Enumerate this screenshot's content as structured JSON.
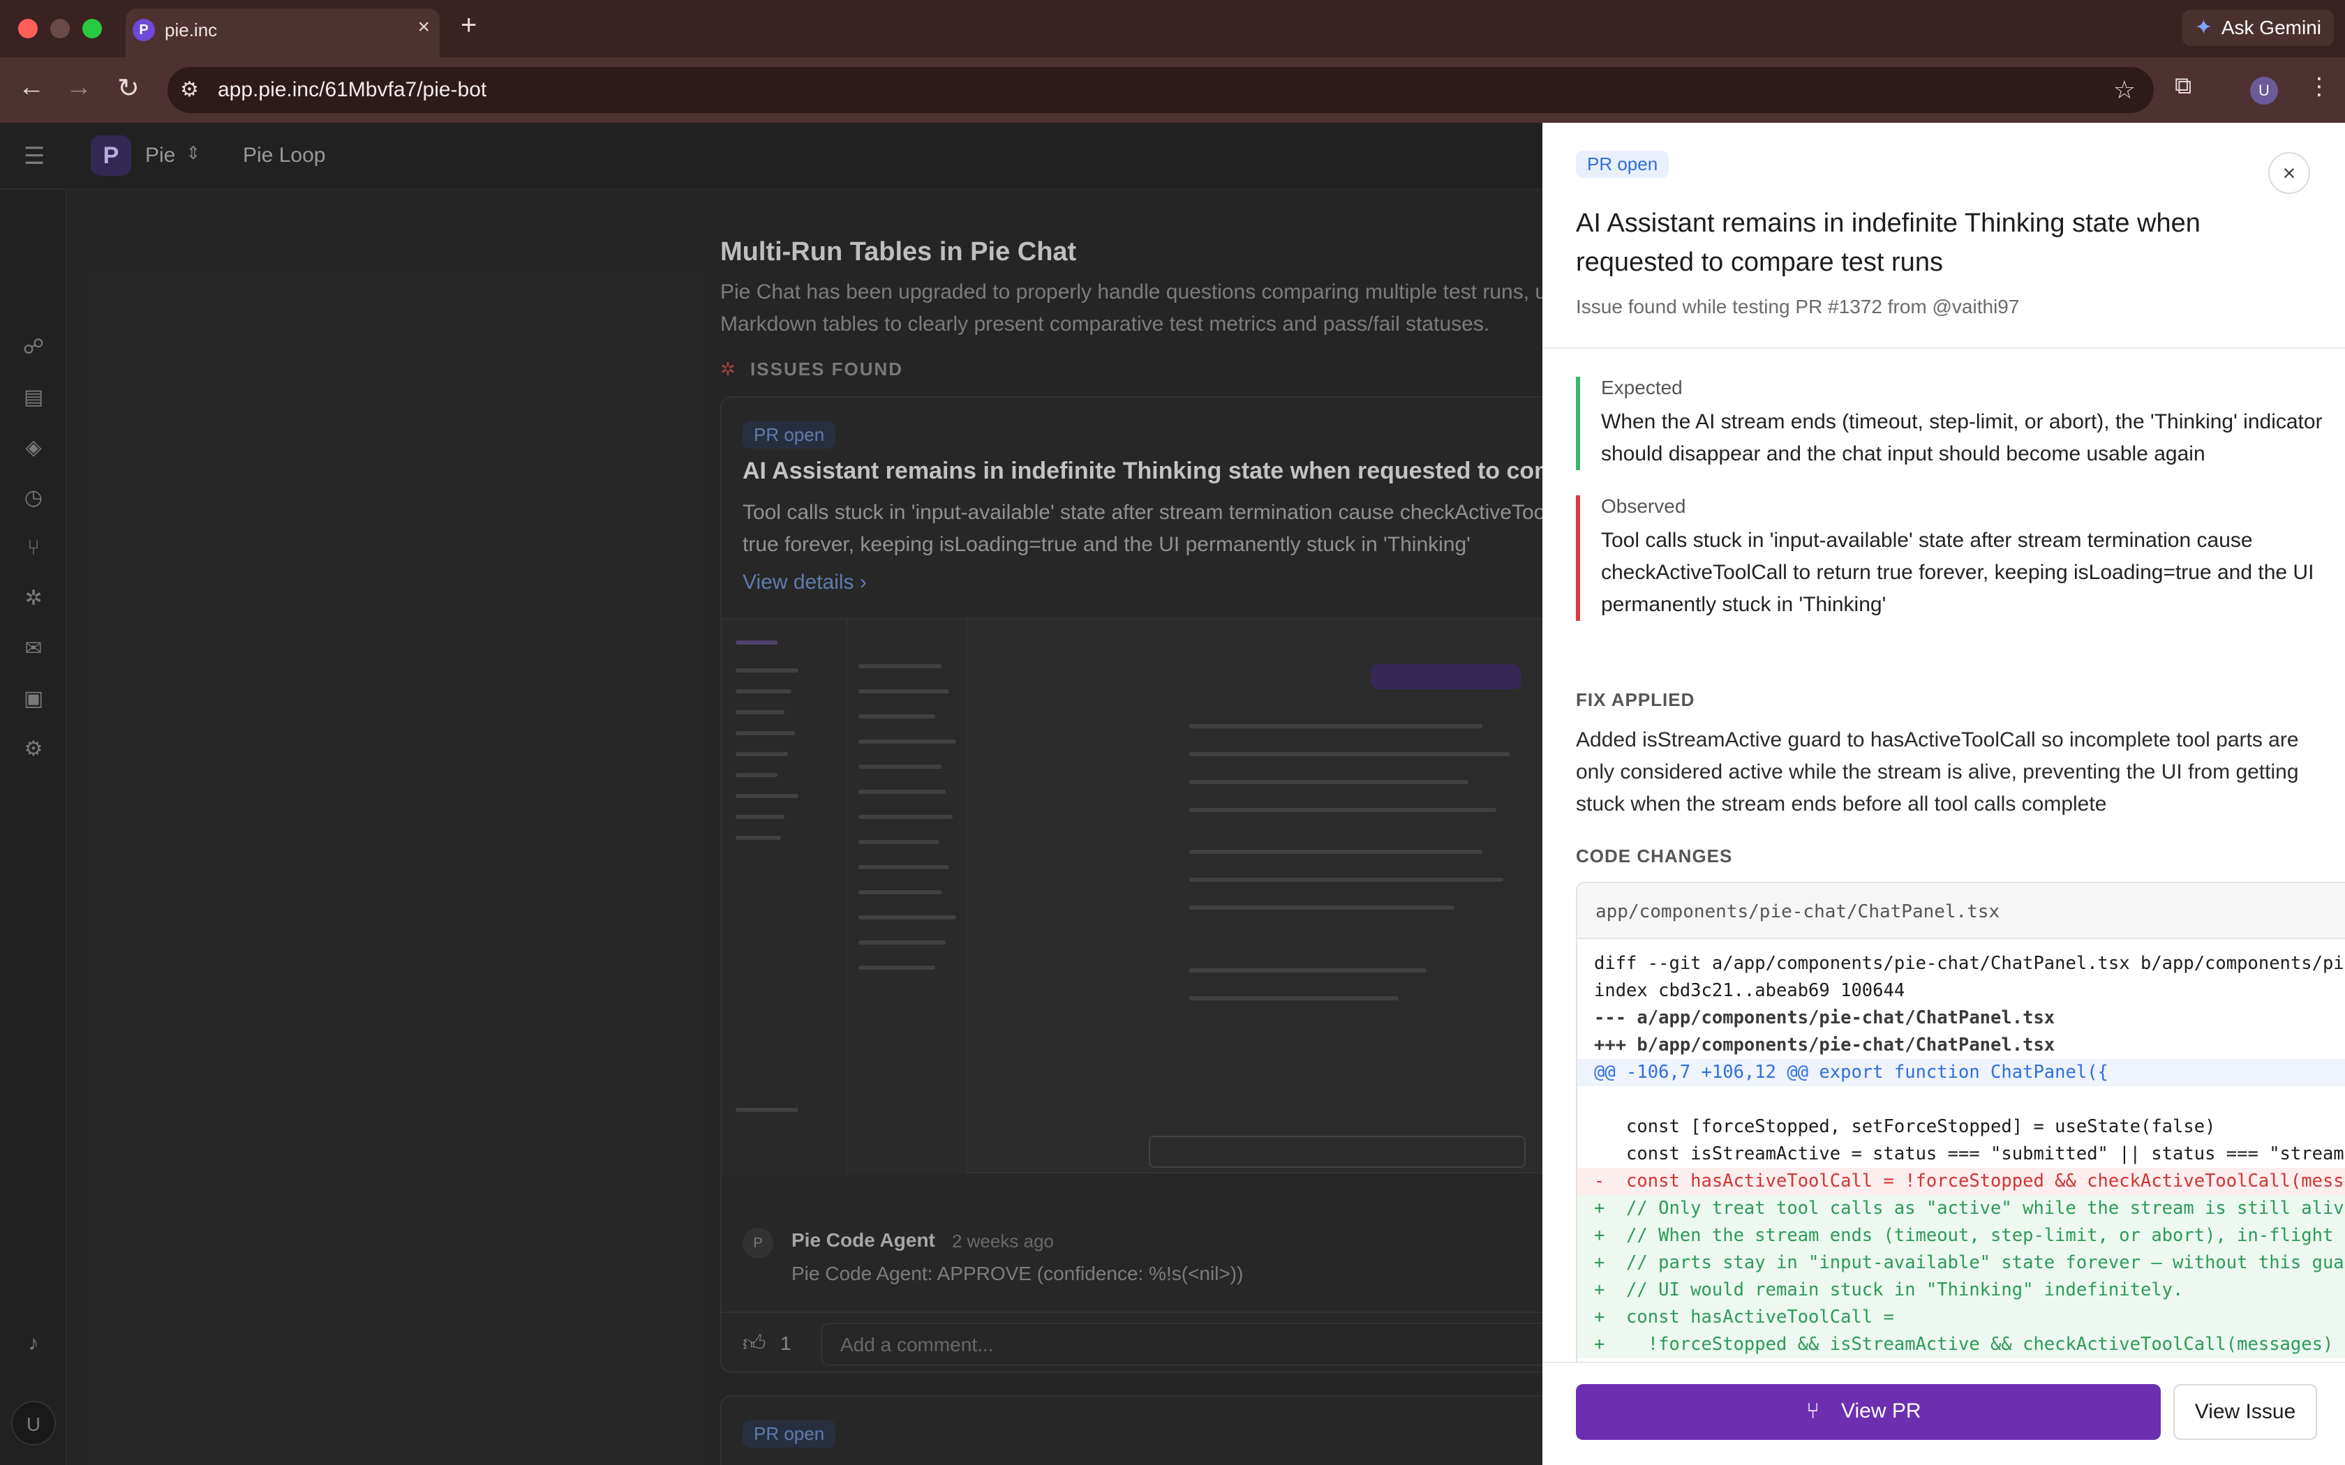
{
  "browser": {
    "tab_title": "pie.inc",
    "favicon_letter": "P",
    "url": "app.pie.inc/61Mbvfa7/pie-bot",
    "gemini_label": "Ask Gemini",
    "profile_initial": "U",
    "colors": {
      "tabbar": "#3b2222",
      "toolbar": "#4e3131",
      "close": "#ff5f57",
      "min": "#febc2e",
      "max": "#28c840"
    }
  },
  "app": {
    "logo_letter": "P",
    "brand": "Pie",
    "breadcrumb": "Pie Loop",
    "sidebar_icons": [
      "groups-icon",
      "clipboard-icon",
      "layers-icon",
      "history-icon",
      "pull-request-icon",
      "bug-icon",
      "chat-icon",
      "bot-icon",
      "settings-icon"
    ],
    "user_initial": "U"
  },
  "main": {
    "feature_title": "Multi-Run Tables in Pie Chat",
    "feature_desc": "Pie Chat has been upgraded to properly handle questions comparing multiple test runs, u Markdown tables to clearly present comparative test metrics and pass/fail statuses.",
    "issues_label": "ISSUES FOUND",
    "card": {
      "status": "PR open",
      "title": "AI Assistant remains in indefinite Thinking state when requested to compare",
      "desc": "Tool calls stuck in 'input-available' state after stream termination cause checkActiveToolC true forever, keeping isLoading=true and the UI permanently stuck in 'Thinking'",
      "view_details": "View details",
      "comment": {
        "avatar_letter": "P",
        "author": "Pie Code Agent",
        "time": "2 weeks ago",
        "body": "Pie Code Agent: APPROVE (confidence: %!s(<nil>))"
      },
      "like_count": "1",
      "comment_placeholder": "Add a comment..."
    },
    "card2_status": "PR open"
  },
  "drawer": {
    "status": "PR open",
    "title": "AI Assistant remains in indefinite Thinking state when requested to compare test runs",
    "subtitle": "Issue found while testing PR #1372 from @vaithi97",
    "expected_label": "Expected",
    "expected_text": "When the AI stream ends (timeout, step-limit, or abort), the 'Thinking' indicator should disappear and the chat input should become usable again",
    "observed_label": "Observed",
    "observed_text": "Tool calls stuck in 'input-available' state after stream termination cause checkActiveToolCall to return true forever, keeping isLoading=true and the UI permanently stuck in 'Thinking'",
    "fix_label": "FIX APPLIED",
    "fix_text": "Added isStreamActive guard to hasActiveToolCall so incomplete tool parts are only considered active while the stream is alive, preventing the UI from getting stuck when the stream ends before all tool calls complete",
    "code_label": "CODE CHANGES",
    "code_file": "app/components/pie-chat/ChatPanel.tsx",
    "code_lines": [
      {
        "type": "meta",
        "text": "diff --git a/app/components/pie-chat/ChatPanel.tsx b/app/components/pie"
      },
      {
        "type": "meta",
        "text": "index cbd3c21..abeab69 100644"
      },
      {
        "type": "hdr",
        "text": "--- a/app/components/pie-chat/ChatPanel.tsx"
      },
      {
        "type": "hdr",
        "text": "+++ b/app/components/pie-chat/ChatPanel.tsx"
      },
      {
        "type": "hunk",
        "text": "@@ -106,7 +106,12 @@ export function ChatPanel({"
      },
      {
        "type": "ctx",
        "text": " "
      },
      {
        "type": "ctx",
        "text": "   const [forceStopped, setForceStopped] = useState(false)"
      },
      {
        "type": "ctx",
        "text": "   const isStreamActive = status === \"submitted\" || status === \"streami"
      },
      {
        "type": "del",
        "text": "-  const hasActiveToolCall = !forceStopped && checkActiveToolCall(messa"
      },
      {
        "type": "add",
        "text": "+  // Only treat tool calls as \"active\" while the stream is still alive"
      },
      {
        "type": "add",
        "text": "+  // When the stream ends (timeout, step-limit, or abort), in-flight t"
      },
      {
        "type": "add",
        "text": "+  // parts stay in \"input-available\" state forever — without this guar"
      },
      {
        "type": "add",
        "text": "+  // UI would remain stuck in \"Thinking\" indefinitely."
      },
      {
        "type": "add",
        "text": "+  const hasActiveToolCall ="
      },
      {
        "type": "add",
        "text": "+    !forceStopped && isStreamActive && checkActiveToolCall(messages)"
      }
    ],
    "view_pr": "View PR",
    "view_issue": "View Issue",
    "colors": {
      "primary": "#6d2fb0",
      "expected": "#3cb371",
      "observed": "#d93c3c",
      "badge_text": "#2f6fdb"
    }
  }
}
